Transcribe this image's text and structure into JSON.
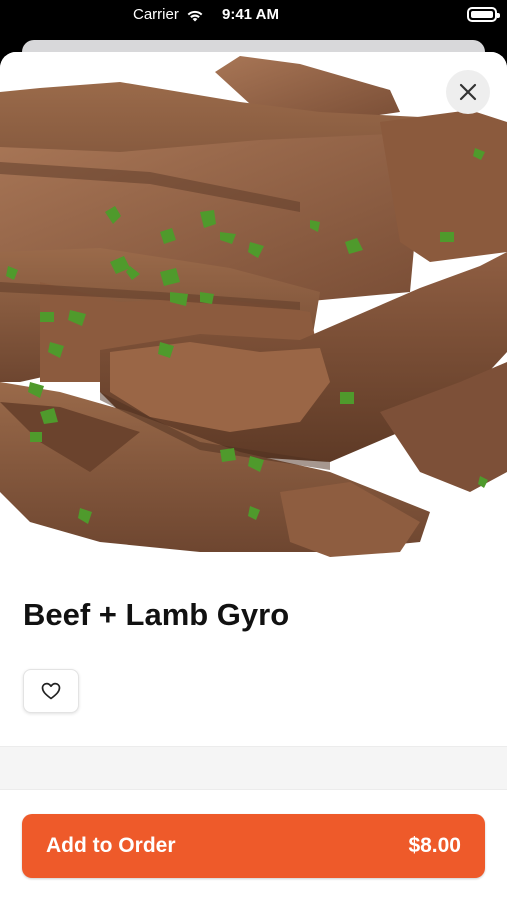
{
  "status_bar": {
    "carrier": "Carrier",
    "time": "9:41 AM",
    "wifi_icon": "wifi-icon",
    "battery_icon": "battery-icon"
  },
  "item": {
    "image_icon": "gyro-meat-photo",
    "title": "Beef + Lamb Gyro",
    "favorite_icon": "heart-icon",
    "close_icon": "close-icon"
  },
  "footer": {
    "add_label": "Add to Order",
    "price": "$8.00"
  },
  "colors": {
    "accent": "#ee5a2a",
    "background": "#ffffff",
    "status_bar": "#000000"
  }
}
